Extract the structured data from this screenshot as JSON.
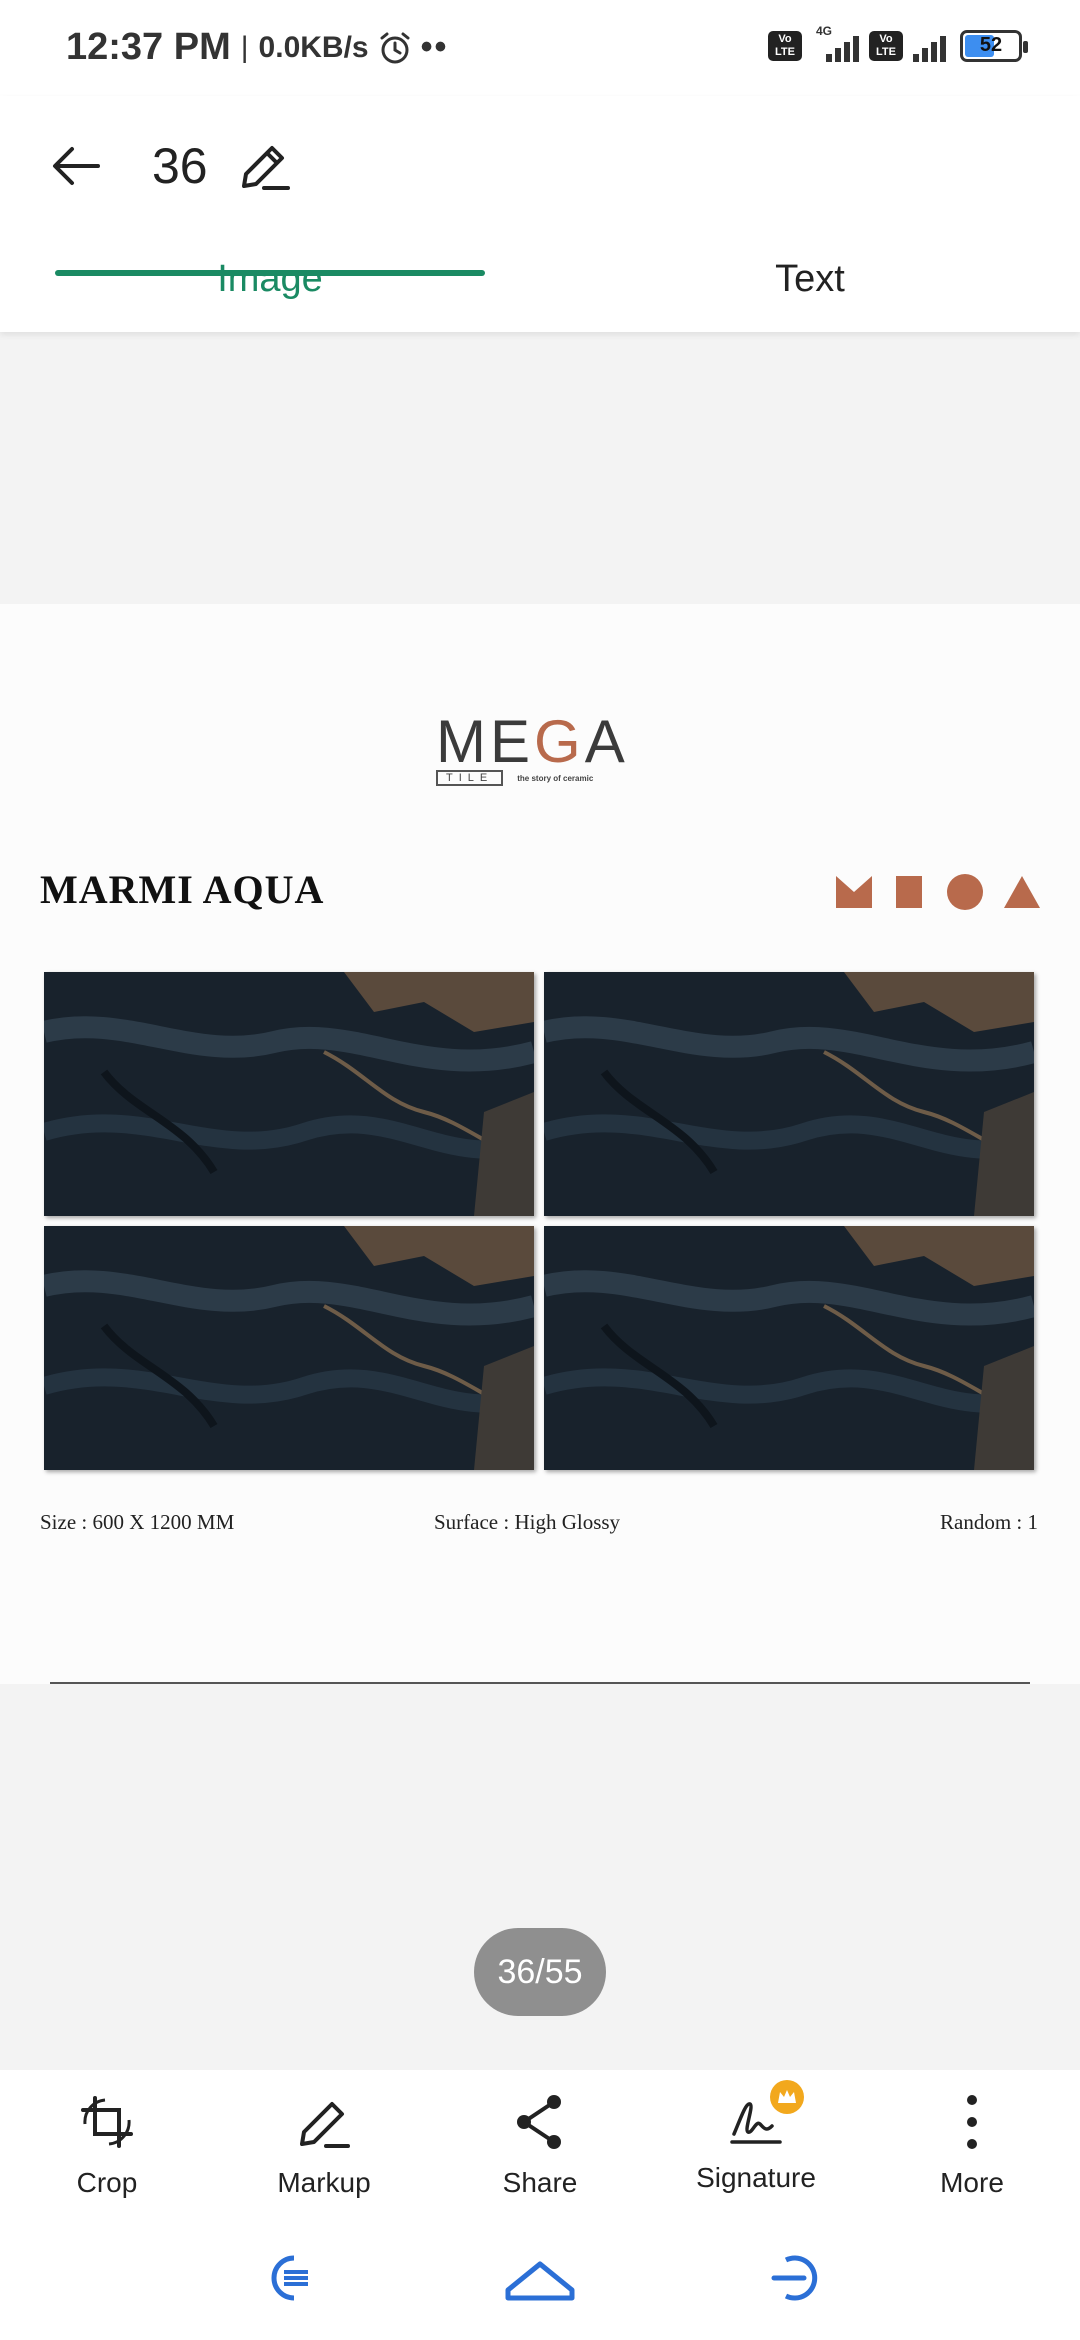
{
  "status": {
    "time": "12:37 PM",
    "network_speed": "0.0KB/s",
    "network_type": "4G",
    "volte": "Vo LTE",
    "battery": "52"
  },
  "header": {
    "title": "36"
  },
  "tabs": [
    {
      "label": "Image",
      "active": true
    },
    {
      "label": "Text",
      "active": false
    }
  ],
  "document": {
    "brand": "MEGA",
    "brand_sub": "TILE",
    "brand_tagline": "the story of ceramic",
    "product_name": "MARMI AQUA",
    "specs": {
      "size": "Size : 600 X 1200 MM",
      "surface": "Surface : High Glossy",
      "random": "Random : 1"
    }
  },
  "page_counter": "36/55",
  "toolbar": [
    {
      "label": "Crop",
      "icon": "crop-icon"
    },
    {
      "label": "Markup",
      "icon": "markup-icon"
    },
    {
      "label": "Share",
      "icon": "share-icon"
    },
    {
      "label": "Signature",
      "icon": "signature-icon"
    },
    {
      "label": "More",
      "icon": "more-vertical-icon"
    }
  ],
  "colors": {
    "accent": "#1a8a63",
    "brand": "#b86a4c"
  }
}
